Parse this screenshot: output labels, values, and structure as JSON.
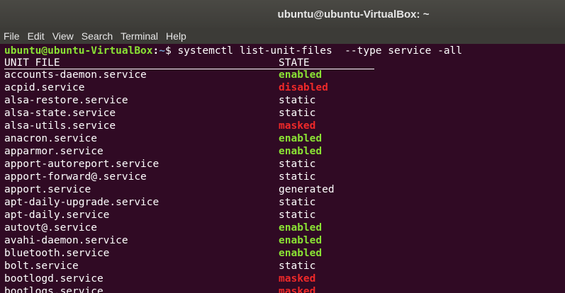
{
  "window": {
    "title": "ubuntu@ubuntu-VirtualBox: ~"
  },
  "menubar": {
    "items": [
      "File",
      "Edit",
      "View",
      "Search",
      "Terminal",
      "Help"
    ]
  },
  "terminal": {
    "prompt": {
      "user_host": "ubuntu@ubuntu-VirtualBox",
      "sep": ":",
      "path": "~",
      "dollar": "$ ",
      "command": "systemctl list-unit-files  --type service -all"
    },
    "headers": {
      "unit_file": "UNIT FILE",
      "state": "STATE"
    },
    "rows": [
      {
        "unit": "accounts-daemon.service",
        "state": "enabled"
      },
      {
        "unit": "acpid.service",
        "state": "disabled"
      },
      {
        "unit": "alsa-restore.service",
        "state": "static"
      },
      {
        "unit": "alsa-state.service",
        "state": "static"
      },
      {
        "unit": "alsa-utils.service",
        "state": "masked"
      },
      {
        "unit": "anacron.service",
        "state": "enabled"
      },
      {
        "unit": "apparmor.service",
        "state": "enabled"
      },
      {
        "unit": "apport-autoreport.service",
        "state": "static"
      },
      {
        "unit": "apport-forward@.service",
        "state": "static"
      },
      {
        "unit": "apport.service",
        "state": "generated"
      },
      {
        "unit": "apt-daily-upgrade.service",
        "state": "static"
      },
      {
        "unit": "apt-daily.service",
        "state": "static"
      },
      {
        "unit": "autovt@.service",
        "state": "enabled"
      },
      {
        "unit": "avahi-daemon.service",
        "state": "enabled"
      },
      {
        "unit": "bluetooth.service",
        "state": "enabled"
      },
      {
        "unit": "bolt.service",
        "state": "static"
      },
      {
        "unit": "bootlogd.service",
        "state": "masked"
      },
      {
        "unit": "bootlogs.service",
        "state": "masked"
      }
    ]
  }
}
